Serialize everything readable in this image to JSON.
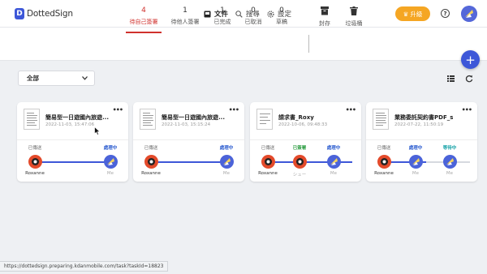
{
  "app": {
    "logo_text": "DottedSign"
  },
  "nav": {
    "documents": "文件",
    "search": "搜尋",
    "settings": "設定"
  },
  "header": {
    "upgrade": "升級",
    "help": "?"
  },
  "status_tabs": [
    {
      "count": "4",
      "label": "待自己簽署",
      "active": true
    },
    {
      "count": "1",
      "label": "待他人簽署",
      "active": false
    },
    {
      "count": "1",
      "label": "已完成",
      "active": false
    },
    {
      "count": "0",
      "label": "已取消",
      "active": false
    },
    {
      "count": "0",
      "label": "草稿",
      "active": false
    }
  ],
  "tools": {
    "archive": "封存",
    "trash": "垃圾桶"
  },
  "fab": {
    "label": "+"
  },
  "filter": {
    "selected": "全部"
  },
  "cards": [
    {
      "title": "簡易型一日遊國內旅遊...",
      "date": "2022-11-03, 15:47:06",
      "stages": [
        {
          "status": "已傳送",
          "name": "Roxanne"
        },
        {
          "status": "處理中",
          "name": "Me"
        }
      ]
    },
    {
      "title": "簡易型一日遊國內旅遊...",
      "date": "2022-11-03, 15:15:24",
      "stages": [
        {
          "status": "已傳送",
          "name": "Roxanne"
        },
        {
          "status": "處理中",
          "name": "Me"
        }
      ]
    },
    {
      "title": "請求書_Roxy",
      "date": "2022-10-06, 09:48:33",
      "stages": [
        {
          "status": "已傳送",
          "name": "Roxanne"
        },
        {
          "status": "已簽署",
          "name": "シュー"
        },
        {
          "status": "處理中",
          "name": "Me"
        }
      ]
    },
    {
      "title": "業務委託契約書PDF_s",
      "date": "2022-07-22, 11:50:19",
      "stages": [
        {
          "status": "已傳送",
          "name": "Roxanne"
        },
        {
          "status": "處理中",
          "name": "Me"
        },
        {
          "status": "等待中",
          "name": "Me"
        }
      ]
    }
  ],
  "status_url": "https://dottedsign.preparing.kdanmobile.com/task?taskId=18823",
  "colors": {
    "brand": "#3d57d8",
    "active_tab": "#d0312d",
    "upgrade": "#f5a623",
    "signer_red": "#e34a2b"
  }
}
